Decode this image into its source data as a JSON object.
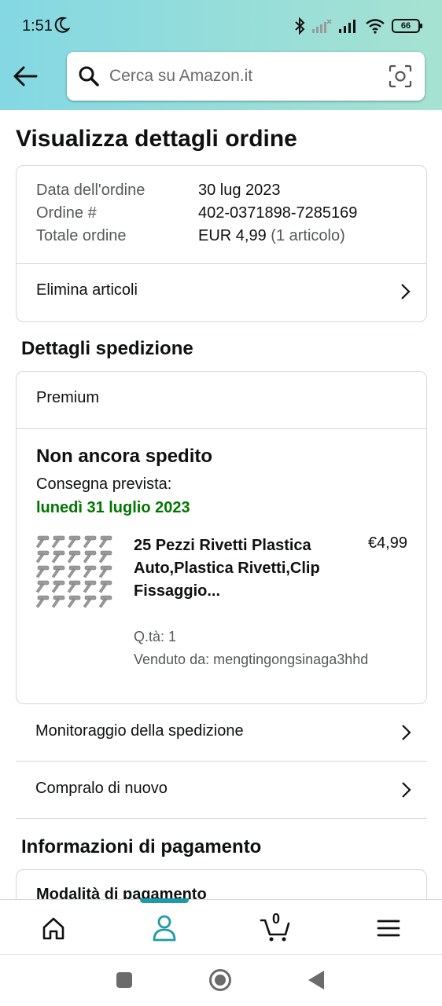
{
  "status_bar": {
    "time": "1:51",
    "battery": "66"
  },
  "search": {
    "placeholder": "Cerca su Amazon.it"
  },
  "page": {
    "title": "Visualizza dettagli ordine"
  },
  "order_summary": {
    "date_label": "Data dell'ordine",
    "date_value": "30 lug 2023",
    "number_label": "Ordine #",
    "number_value": "402-0371898-7285169",
    "total_label": "Totale ordine",
    "total_value": "EUR 4,99",
    "total_items": "(1 articolo)",
    "delete_items": "Elimina articoli"
  },
  "shipping": {
    "section_title": "Dettagli spedizione",
    "method": "Premium",
    "status": "Non ancora spedito",
    "delivery_label": "Consegna prevista:",
    "delivery_date": "lunedì 31 luglio 2023",
    "item": {
      "title": "25 Pezzi Rivetti Plastica Auto,Plastica Rivetti,Clip Fissaggio...",
      "price": "€4,99",
      "qty": "Q.tà: 1",
      "seller": "Venduto da: mengtingongsinaga3hhd"
    },
    "track": "Monitoraggio della spedizione",
    "buy_again": "Compralo di nuovo"
  },
  "payment": {
    "section_title": "Informazioni di pagamento",
    "method_label": "Modalità di pagamento"
  },
  "bottom_nav": {
    "cart_count": "0"
  },
  "colors": {
    "accent": "#1e9ba6",
    "delivery_green": "#007600",
    "header_start": "#84d8e3",
    "header_end": "#a6e2d1"
  }
}
